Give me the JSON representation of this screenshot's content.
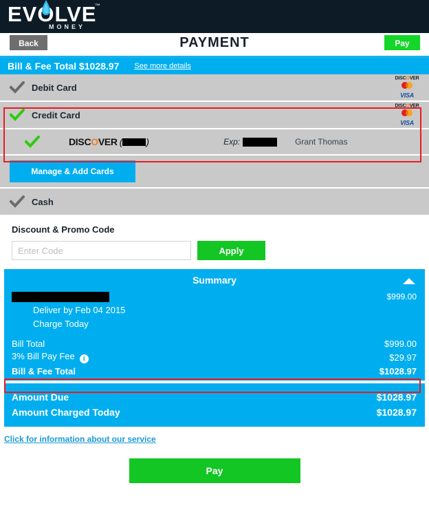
{
  "brand": {
    "name_before_o": "EV",
    "name_o": "O",
    "name_after_o": "LVE",
    "tm": "™",
    "tagline": "MONEY"
  },
  "titlebar": {
    "back_label": "Back",
    "title": "PAYMENT",
    "pay_label": "Pay"
  },
  "bill_strip": {
    "label": "Bill & Fee Total $1028.97",
    "details_link": "See more details"
  },
  "methods": [
    {
      "id": "debit-card",
      "label": "Debit Card",
      "check_color": "#6b6b6b",
      "selected": false
    },
    {
      "id": "credit-card",
      "label": "Credit Card",
      "check_color": "#2ecc0f",
      "selected": true
    }
  ],
  "card_brands": {
    "discover_pre": "DISC",
    "discover_o": "O",
    "discover_post": "VER",
    "visa": "VISA"
  },
  "saved_card": {
    "brand_pre": "DISC",
    "brand_o": "O",
    "brand_post": "VER",
    "number_open_paren": "(",
    "number_redacted": true,
    "number_close_paren": ")",
    "exp_label": "Exp:",
    "exp_redacted": true,
    "holder_name": "Grant Thomas"
  },
  "manage_button": {
    "label": "Manage & Add Cards"
  },
  "cash_method": {
    "label": "Cash",
    "check_color": "#6b6b6b"
  },
  "promo": {
    "title": "Discount & Promo Code",
    "placeholder": "Enter Code",
    "value": "",
    "apply_label": "Apply"
  },
  "summary": {
    "title": "Summary",
    "collapse_icon": "caret-up",
    "item": {
      "payee_redacted": true,
      "amount": "$999.00",
      "deliver_by": "Deliver by Feb 04 2015",
      "charge_when": "Charge Today"
    },
    "totals": [
      {
        "label": "Bill Total",
        "amount": "$999.00",
        "bold": false,
        "info": false
      },
      {
        "label": "3% Bill Pay Fee",
        "amount": "$29.97",
        "bold": false,
        "info": true
      },
      {
        "label": "Bill & Fee Total",
        "amount": "$1028.97",
        "bold": true,
        "info": false
      }
    ],
    "info_icon_glyph": "i"
  },
  "amounts": [
    {
      "label": "Amount Due",
      "amount": "$1028.97"
    },
    {
      "label": "Amount Charged Today",
      "amount": "$1028.97"
    }
  ],
  "service_link": "Click for information about our service",
  "pay_button": {
    "label": "Pay"
  },
  "colors": {
    "brand_dark": "#0d1b26",
    "accent_blue": "#00aeef",
    "green": "#13c623",
    "row_gray": "#c9c9c9",
    "highlight_red": "#e81b23"
  }
}
